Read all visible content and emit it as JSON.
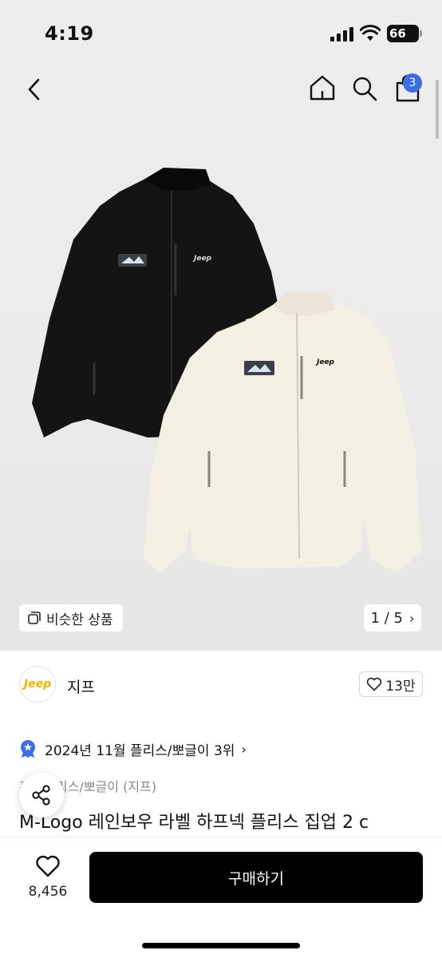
{
  "status_bar": {
    "time": "4:19",
    "battery": "66"
  },
  "nav": {
    "cart_count": "3"
  },
  "gallery": {
    "similar_label": "비슷한 상품",
    "page_indicator": "1 / 5",
    "chevron": "›"
  },
  "brand": {
    "logo_text": "Jeep",
    "name": "지프",
    "like_count": "13만",
    "logo_color": "#f0b400"
  },
  "ranking": {
    "text": "2024년 11월 플리스/뽀글이 3위",
    "chevron": "›"
  },
  "product": {
    "category": "홈 › 플리스/뽀글이 (지프)",
    "title": "M-Logo 레인보우 라벨 하프넥 플리스 집업 2 c"
  },
  "bottom": {
    "wish_count": "8,456",
    "buy_label": "구매하기"
  },
  "colors": {
    "accent_badge": "#3b6de4",
    "buy_button": "#000000"
  }
}
